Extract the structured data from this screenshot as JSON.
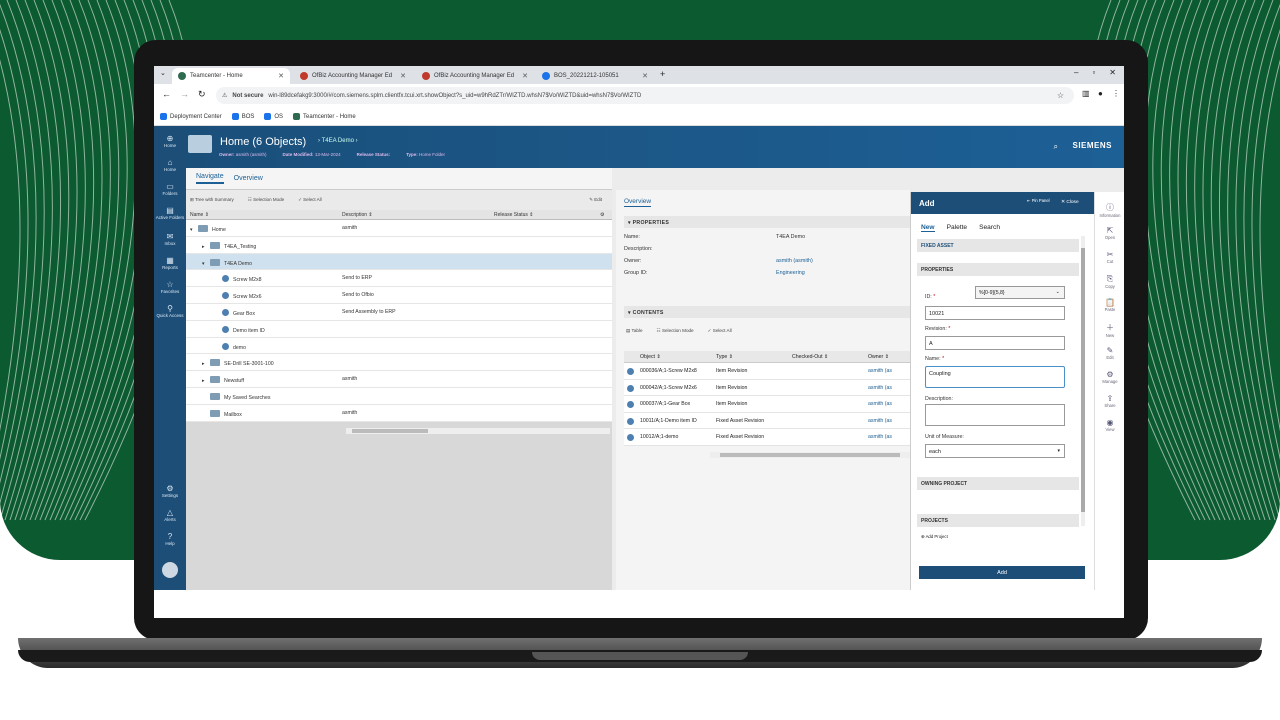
{
  "colors": {
    "accent": "#1d6096",
    "bg_green": "#0c5a2f",
    "nav": "#1d4e78"
  },
  "browser": {
    "tabs": [
      "Teamcenter - Home",
      "OfBiz Accounting Manager Ed",
      "OfBiz Accounting Manager Ed",
      "BOS_20221212-105051"
    ],
    "url_secure": "Not secure",
    "url": "win-l89dcefakg9:3000/#/com.siemens.splm.clientfx.tcui.xrt.showObject?s_uid=w9hRdZTr/WIZTD.whsN7$Vo/WIZTD&uid=whsN7$Vo/WIZTD",
    "bookmarks": [
      "Deployment Center",
      "BOS",
      "OS",
      "Teamcenter - Home"
    ]
  },
  "leftnav": [
    {
      "label": "Home",
      "icon": "home-circle-icon"
    },
    {
      "label": "Home",
      "icon": "home-icon"
    },
    {
      "label": "Folders",
      "icon": "folder-icon"
    },
    {
      "label": "Active Folders",
      "icon": "active-folder-icon"
    },
    {
      "label": "Inbox",
      "icon": "inbox-icon"
    },
    {
      "label": "Reports",
      "icon": "reports-icon"
    },
    {
      "label": "Favorites",
      "icon": "star-icon"
    },
    {
      "label": "Quick Access",
      "icon": "quick-access-icon"
    }
  ],
  "leftnav_bottom": [
    "Settings",
    "Alerts",
    "Help"
  ],
  "header": {
    "title": "Home (6 Objects)",
    "crumb": "T4EA Demo",
    "owner_label": "Owner:",
    "owner": "asmith (asmith)",
    "date_label": "Date Modified:",
    "date": "13-Mar-2024",
    "status_label": "Release Status:",
    "type_label": "Type:",
    "type": "Home Folder",
    "brand": "SIEMENS"
  },
  "subtabs": [
    "Navigate",
    "Overview"
  ],
  "toolbar": [
    "Tree with Summary",
    "Selection Mode",
    "Select All",
    "Edit"
  ],
  "grid": {
    "columns": [
      "Name",
      "Description",
      "Release Status"
    ],
    "rows": [
      {
        "name": "Home",
        "desc": "asmith",
        "kind": "folder",
        "indent": 0,
        "exp": "▾"
      },
      {
        "name": "T4EA_Testing",
        "desc": "",
        "kind": "folder",
        "indent": 1,
        "exp": "▸"
      },
      {
        "name": "T4EA Demo",
        "desc": "",
        "kind": "folder",
        "indent": 1,
        "exp": "▾"
      },
      {
        "name": "Screw M2x8",
        "desc": "Send to ERP",
        "kind": "item",
        "indent": 2,
        "exp": ""
      },
      {
        "name": "Screw M2x6",
        "desc": "Send to Ofbio",
        "kind": "item",
        "indent": 2,
        "exp": ""
      },
      {
        "name": "Gear Box",
        "desc": "Send Assembly to ERP",
        "kind": "item",
        "indent": 2,
        "exp": ""
      },
      {
        "name": "Demo item ID",
        "desc": "",
        "kind": "item",
        "indent": 2,
        "exp": ""
      },
      {
        "name": "demo",
        "desc": "",
        "kind": "item",
        "indent": 2,
        "exp": ""
      },
      {
        "name": "SE-Drill SE-3001-100",
        "desc": "",
        "kind": "folder",
        "indent": 1,
        "exp": "▸"
      },
      {
        "name": "Newstuff",
        "desc": "asmith",
        "kind": "folder",
        "indent": 1,
        "exp": "▸"
      },
      {
        "name": "My Saved Searches",
        "desc": "",
        "kind": "folder",
        "indent": 1,
        "exp": ""
      },
      {
        "name": "Mailbox",
        "desc": "asmith",
        "kind": "folder",
        "indent": 1,
        "exp": ""
      }
    ]
  },
  "overview": {
    "tab": "Overview",
    "properties_title": "PROPERTIES",
    "props": [
      {
        "label": "Name:",
        "value": "T4EA Demo",
        "link": false
      },
      {
        "label": "Description:",
        "value": "",
        "link": false
      },
      {
        "label": "Owner:",
        "value": "asmith (asmith)",
        "link": true
      },
      {
        "label": "Group ID:",
        "value": "Engineering",
        "link": true
      }
    ],
    "contents_title": "CONTENTS",
    "contents_toolbar": [
      "Table",
      "Selection Mode",
      "Select All"
    ],
    "columns": [
      "Object",
      "Type",
      "Checked-Out",
      "Owner"
    ],
    "rows": [
      {
        "object": "000036/A;1-Screw M2x8",
        "type": "Item Revision",
        "owner": "asmith (as"
      },
      {
        "object": "000042/A;1-Screw M2x6",
        "type": "Item Revision",
        "owner": "asmith (as"
      },
      {
        "object": "000037/A;1-Gear Box",
        "type": "Item Revision",
        "owner": "asmith (as"
      },
      {
        "object": "10011/A;1-Demo item ID",
        "type": "Fixed Asset Revision",
        "owner": "asmith (as"
      },
      {
        "object": "10012/A;1-demo",
        "type": "Fixed Asset Revision",
        "owner": "asmith (as"
      }
    ]
  },
  "add": {
    "title": "Add",
    "pin": "Pin Panel",
    "close": "Close",
    "tabs": [
      "New",
      "Palette",
      "Search"
    ],
    "type": "FIXED ASSET",
    "properties": "PROPERTIES",
    "id_label": "ID:",
    "id_pattern": "%[0-9]{5,8}",
    "id_value": "10021",
    "rev_label": "Revision:",
    "rev_value": "A",
    "name_label": "Name:",
    "name_value": "Coupling",
    "desc_label": "Description:",
    "uom_label": "Unit of Measure:",
    "uom_value": "each",
    "owning_project": "OWNING PROJECT",
    "projects": "PROJECTS",
    "add_project": "Add Project",
    "add_button": "Add"
  },
  "rightbar": [
    "Information",
    "Open",
    "Cut",
    "Copy",
    "Paste",
    "New",
    "Edit",
    "Manage",
    "Share",
    "View"
  ]
}
